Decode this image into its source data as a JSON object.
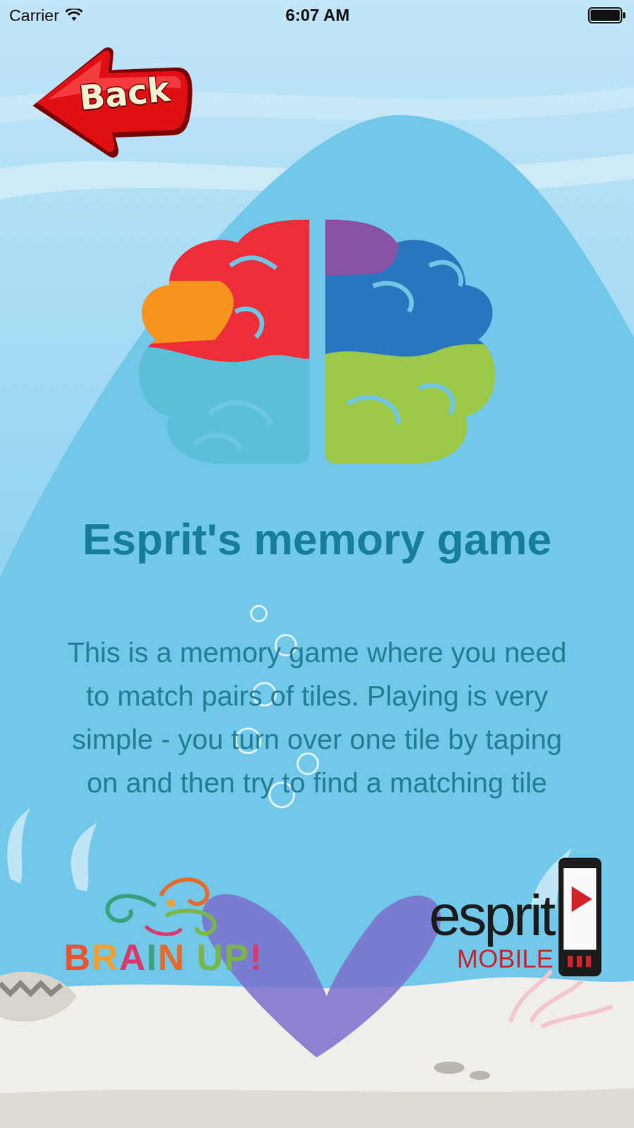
{
  "status_bar": {
    "carrier": "Carrier",
    "time": "6:07 AM",
    "wifi": true,
    "battery_level": 1
  },
  "back_button": {
    "label": "Back"
  },
  "title": "Esprit's memory game",
  "description": "This is a memory game where you need to match pairs of tiles. Playing is very simple - you turn over one tile by taping on and then try to find a matching tile",
  "partners": [
    {
      "kind": "brainup",
      "text": "BRAIN UP!"
    },
    {
      "kind": "esprit",
      "text": "esprit",
      "subtitle": "MOBILE"
    }
  ]
}
